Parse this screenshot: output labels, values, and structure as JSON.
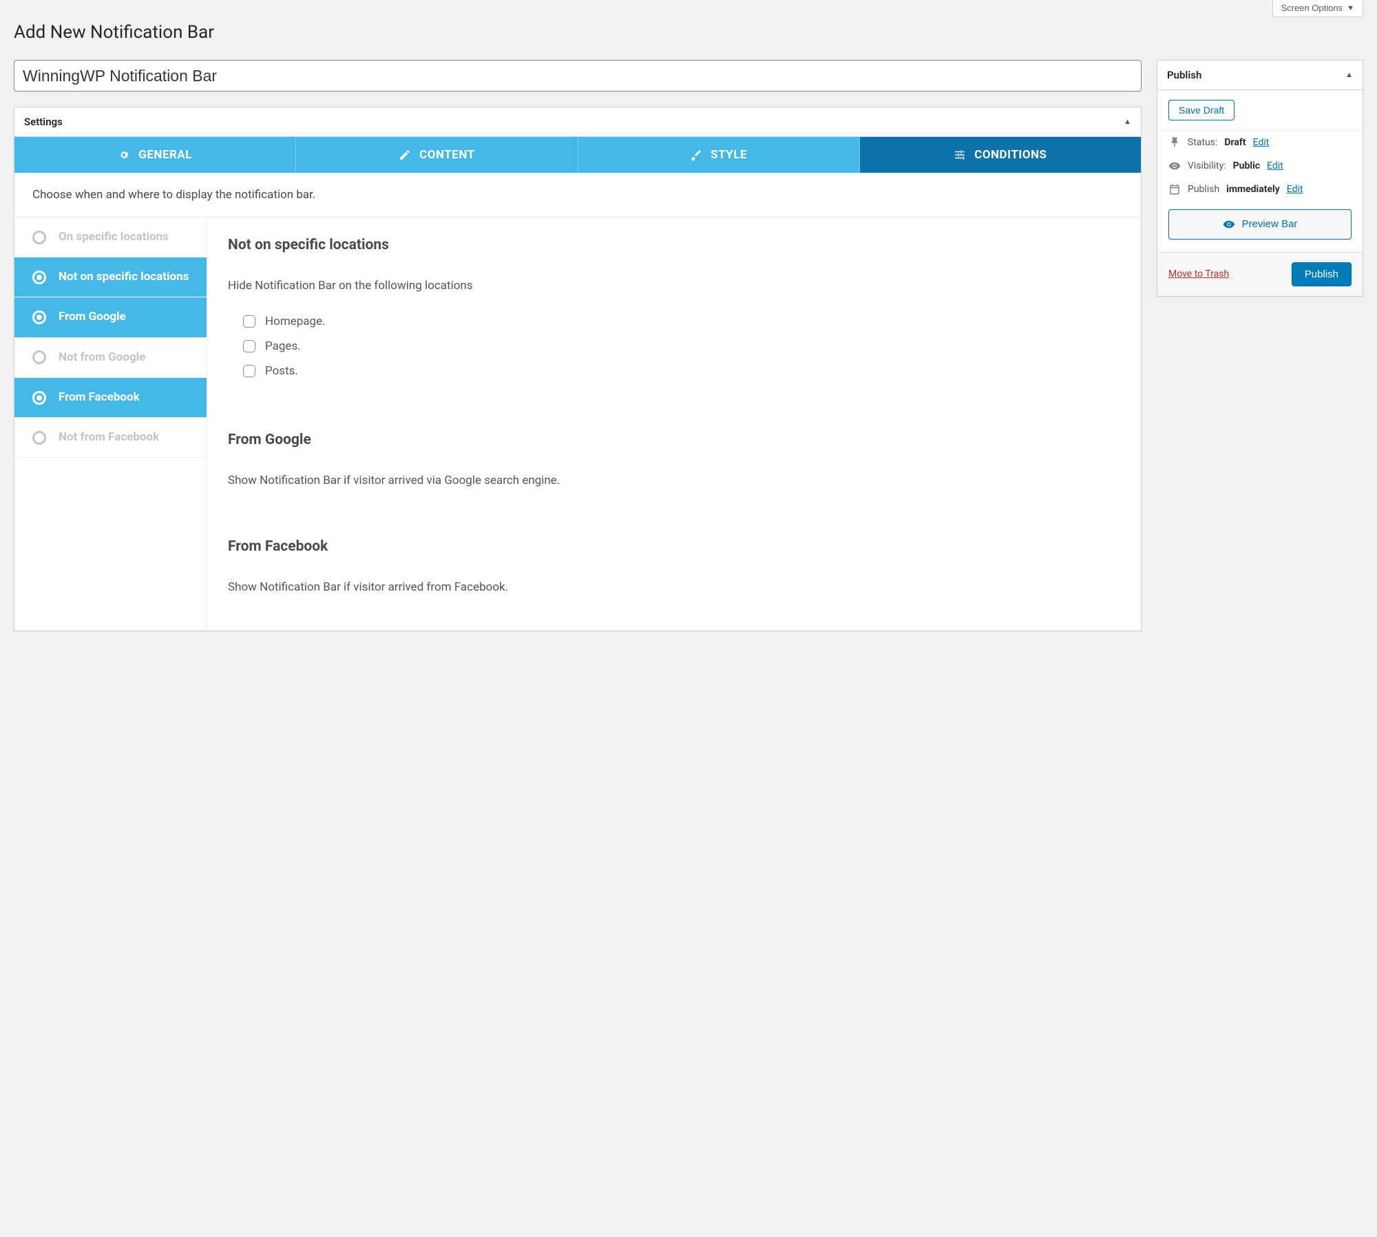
{
  "header": {
    "screen_options": "Screen Options",
    "page_title": "Add New Notification Bar",
    "title_value": "WinningWP Notification Bar"
  },
  "settings_panel": {
    "title": "Settings",
    "tabs": {
      "general": "GENERAL",
      "content": "CONTENT",
      "style": "STYLE",
      "conditions": "CONDITIONS"
    },
    "intro": "Choose when and where to display the notification bar.",
    "side_nav": [
      {
        "label": "On specific locations",
        "selected": false
      },
      {
        "label": "Not on specific locations",
        "selected": true
      },
      {
        "label": "From Google",
        "selected": true
      },
      {
        "label": "Not from Google",
        "selected": false
      },
      {
        "label": "From Facebook",
        "selected": true
      },
      {
        "label": "Not from Facebook",
        "selected": false
      }
    ],
    "sections": {
      "not_locations": {
        "heading": "Not on specific locations",
        "desc": "Hide Notification Bar on the following locations",
        "options": {
          "home": "Homepage.",
          "pages": "Pages.",
          "posts": "Posts."
        }
      },
      "google": {
        "heading": "From Google",
        "desc": "Show Notification Bar if visitor arrived via Google search engine."
      },
      "facebook": {
        "heading": "From Facebook",
        "desc": "Show Notification Bar if visitor arrived from Facebook."
      }
    }
  },
  "publish": {
    "title": "Publish",
    "save_draft": "Save Draft",
    "status_label": "Status:",
    "status_value": "Draft",
    "visibility_label": "Visibility:",
    "visibility_value": "Public",
    "schedule_label": "Publish",
    "schedule_value": "immediately",
    "edit": "Edit",
    "preview": "Preview Bar",
    "trash": "Move to Trash",
    "publish_btn": "Publish"
  }
}
